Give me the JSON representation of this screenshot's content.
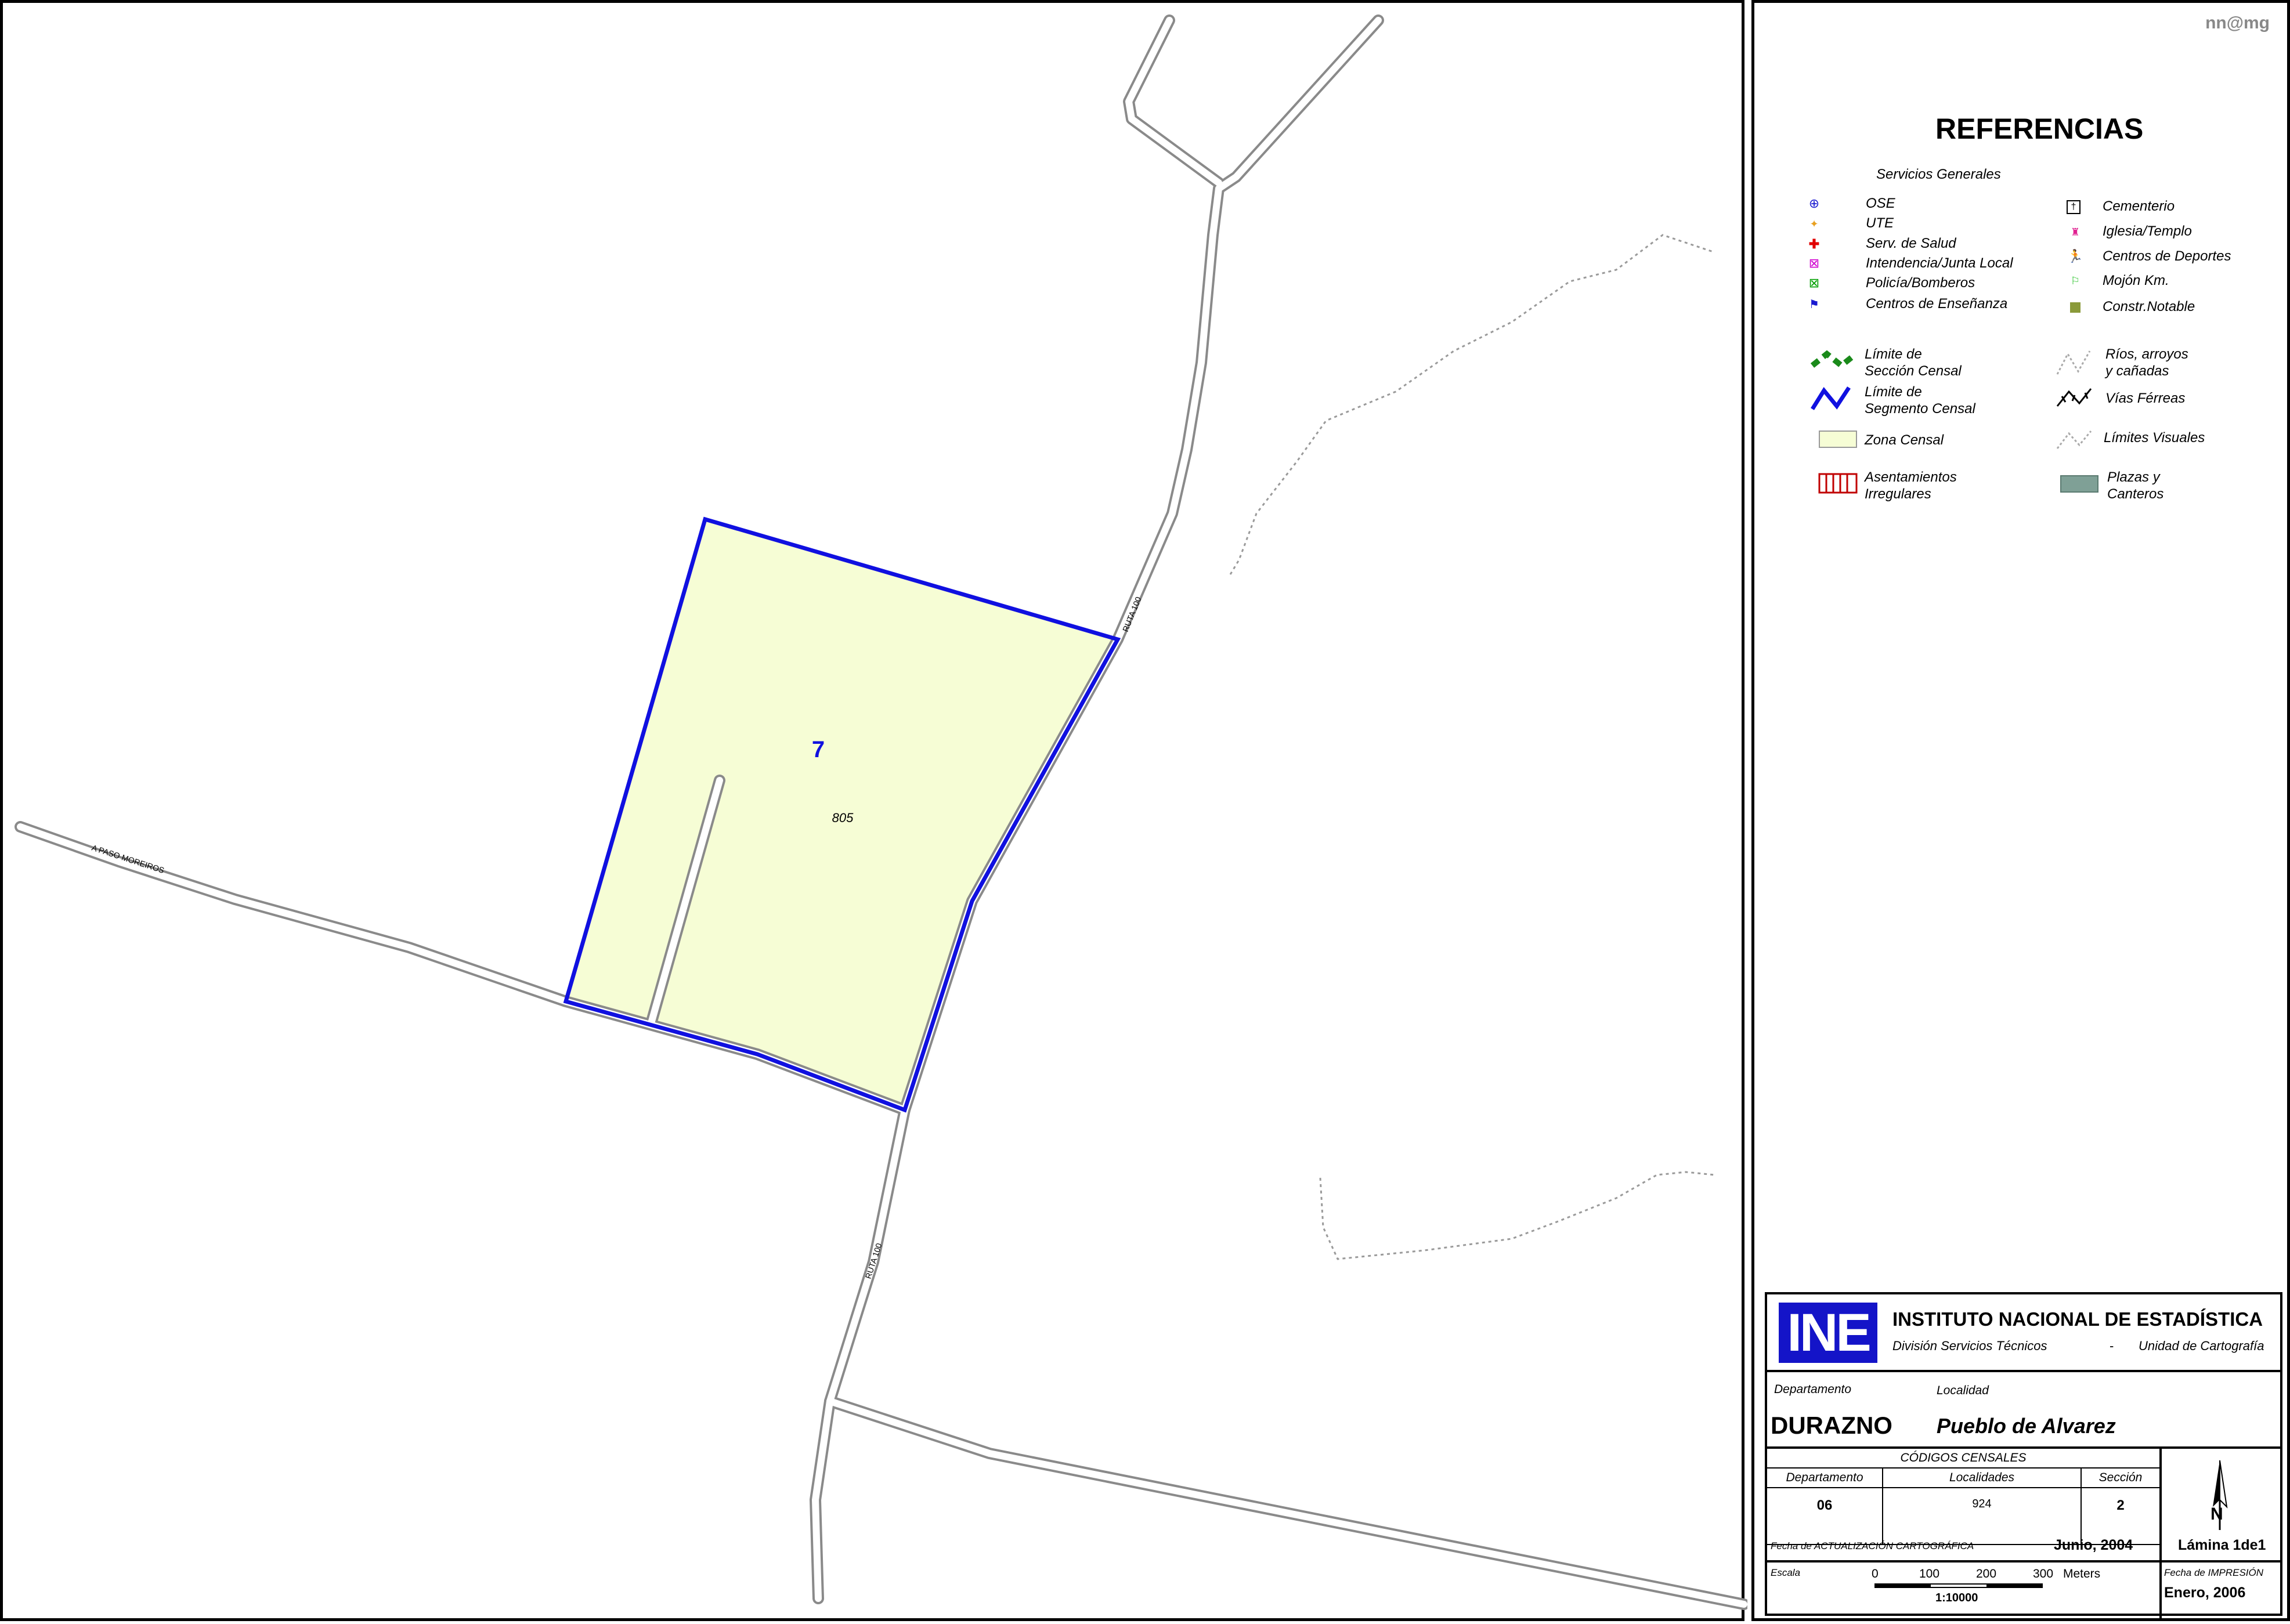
{
  "watermark": "nn@mg",
  "map": {
    "segment_number": "7",
    "zone_code": "805",
    "road_labels": {
      "paso_moreiros": "A PASO MOREIROS",
      "ruta_north": "RUTA 100",
      "ruta_south": "RUTA 100"
    },
    "colors": {
      "zone_fill": "#F6FDD5",
      "segment_border": "#1010E0",
      "road": "#8A8A8A",
      "visual_limit": "#9A9A9A"
    }
  },
  "legend": {
    "title": "REFERENCIAS",
    "services_heading": "Servicios Generales",
    "services_left": [
      {
        "icon": "ose-icon",
        "label": "OSE"
      },
      {
        "icon": "ute-icon",
        "label": "UTE"
      },
      {
        "icon": "health-cross-icon",
        "label": "Serv. de Salud"
      },
      {
        "icon": "intendencia-icon",
        "label": "Intendencia/Junta Local"
      },
      {
        "icon": "police-icon",
        "label": "Policía/Bomberos"
      },
      {
        "icon": "school-flag-icon",
        "label": "Centros de Enseñanza"
      }
    ],
    "services_right": [
      {
        "icon": "cemetery-icon",
        "label": "Cementerio"
      },
      {
        "icon": "church-icon",
        "label": "Iglesia/Templo"
      },
      {
        "icon": "sports-icon",
        "label": "Centros de Deportes"
      },
      {
        "icon": "km-marker-icon",
        "label": "Mojón Km."
      },
      {
        "icon": "notable-building-icon",
        "label": "Constr.Notable"
      }
    ],
    "limits": {
      "seccion_1": "Límite de",
      "seccion_2": "Sección Censal",
      "segmento_1": "Límite de",
      "segmento_2": "Segmento Censal",
      "zona": "Zona Censal",
      "asent_1": "Asentamientos",
      "asent_2": "Irregulares",
      "rios_1": "Ríos, arroyos",
      "rios_2": "y cañadas",
      "vias": "Vías Férreas",
      "limites_visuales": "Límites  Visuales",
      "plazas_1": "Plazas y",
      "plazas_2": "Canteros"
    }
  },
  "titleblock": {
    "institute": "INSTITUTO NACIONAL DE ESTADÍSTICA",
    "division": "División Servicios Técnicos",
    "dash": "-",
    "unit": "Unidad de Cartografía",
    "departamento_label": "Departamento",
    "localidad_label": "Localidad",
    "departamento": "DURAZNO",
    "localidad": "Pueblo de Alvarez",
    "codigos_label": "CÓDIGOS CENSALES",
    "cod_dep_label": "Departamento",
    "cod_loc_label": "Localidades",
    "cod_sec_label": "Sección",
    "cod_dep": "06",
    "cod_loc": "924",
    "cod_sec": "2",
    "actualizacion_label": "Fecha de ACTUALIZACIÓN CARTOGRÁFICA",
    "actualizacion": "Junio, 2004",
    "lamina": "Lámina 1de1",
    "escala_label": "Escala",
    "scale_ticks": [
      "0",
      "100",
      "200",
      "300"
    ],
    "scale_units": "Meters",
    "scale_ratio": "1:10000",
    "impresion_label": "Fecha de IMPRESIÓN",
    "impresion": "Enero, 2006",
    "north": "N",
    "logo": "INE"
  }
}
